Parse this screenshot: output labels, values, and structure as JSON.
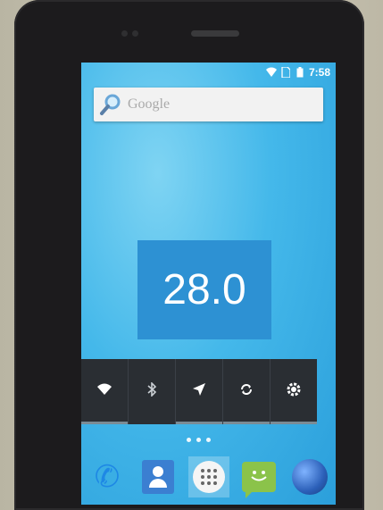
{
  "status_bar": {
    "time": "7:58",
    "icons": [
      "wifi-icon",
      "sim-icon",
      "battery-icon"
    ]
  },
  "search": {
    "placeholder": "Google",
    "icon": "magnifier-icon"
  },
  "widget": {
    "value": "28.0"
  },
  "quick_settings": {
    "tiles": [
      "wifi-icon",
      "bluetooth-icon",
      "location-icon",
      "sync-icon",
      "brightness-icon"
    ]
  },
  "page_indicator": {
    "count": 3
  },
  "dock": {
    "apps": [
      "phone-icon",
      "contacts-icon",
      "app-drawer-icon",
      "messaging-icon",
      "browser-icon"
    ]
  },
  "colors": {
    "wallpaper": "#3bb0e6",
    "widget_bg": "#2d91d3",
    "quick_settings_bg": "#2a2e33"
  }
}
